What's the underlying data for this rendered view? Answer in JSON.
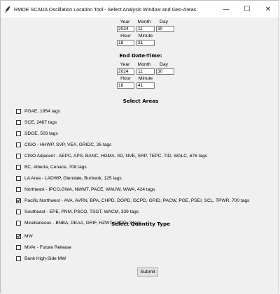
{
  "window": {
    "title": "RMOE SCADA Oscillation Location Tool - Select Analysis Window and Geo-Areas",
    "controls": {
      "minimize": "—",
      "maximize": "☐",
      "close": "✕"
    }
  },
  "start": {
    "labels": {
      "year": "Year",
      "month": "Month",
      "day": "Day",
      "hour": "Hour",
      "minute": "Minute"
    },
    "values": {
      "year": "2024",
      "month": "11",
      "day": "30",
      "hour": "18",
      "minute": "31"
    }
  },
  "end": {
    "title": "End Date-Time:",
    "labels": {
      "year": "Year",
      "month": "Month",
      "day": "Day",
      "hour": "Hour",
      "minute": "Minute"
    },
    "values": {
      "year": "2024",
      "month": "11",
      "day": "30",
      "hour": "18",
      "minute": "41"
    }
  },
  "areas": {
    "title": "Select Areas",
    "items": [
      {
        "label": "PGAE, 1954 tags",
        "checked": false
      },
      {
        "label": "SCE, 2487 tags",
        "checked": false
      },
      {
        "label": "SDGE, 503 tags",
        "checked": false
      },
      {
        "label": "CISO - HHWP, SVP, VEA, GRIDC, 26 tags",
        "checked": false
      },
      {
        "label": "CISO Adjacent - AEPC, APS, BANC, HGMA, IID, NVE, SRP, TEPC, TID, WALC, 676 tags",
        "checked": false
      },
      {
        "label": "BC, Alberta, Cenace, 708 tags",
        "checked": false
      },
      {
        "label": "LA Area - LADWP, Glendale, Burbank, 125 tags",
        "checked": false
      },
      {
        "label": "Northeast - IPCO,GWA, NWMT, PACE, WAUW, WWA, 424 tags",
        "checked": false
      },
      {
        "label": "Pacific Northwest - AVA, AVRN, BPA, CHPD, DOPD, GCPD, GRID, PACW, PGE, PSEI, SCL, TPWR, 700 tags",
        "checked": true
      },
      {
        "label": "Southeast - EPE, PNM,  PSCO, TSGT, WACM, 339 tags",
        "checked": false
      },
      {
        "label": "Micellaneous - BNBA, DEAA, GRIF, HZWT, LSPG, 7 tags",
        "checked": false
      }
    ]
  },
  "quantity": {
    "title": "Select Quantity Type",
    "items": [
      {
        "label": "MW",
        "checked": true
      },
      {
        "label": "MVAr - Future Release",
        "checked": false
      },
      {
        "label": "Bank High-Side MW",
        "checked": false
      }
    ]
  },
  "submit_label": "Submit"
}
